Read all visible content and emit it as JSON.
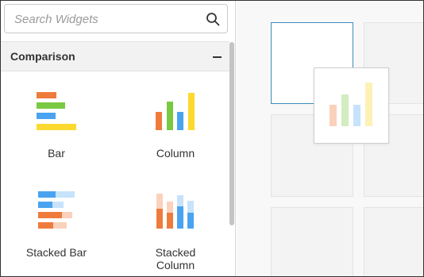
{
  "search": {
    "placeholder": "Search Widgets",
    "value": "",
    "icon": "search-icon"
  },
  "group": {
    "title": "Comparison",
    "collapse_icon": "minus-icon"
  },
  "widgets": [
    {
      "label": "Bar",
      "icon": "bar-chart-icon"
    },
    {
      "label": "Column",
      "icon": "column-chart-icon"
    },
    {
      "label": "Stacked Bar",
      "icon": "stacked-bar-chart-icon"
    },
    {
      "label": "Stacked Column",
      "icon": "stacked-column-chart-icon"
    }
  ],
  "drag_preview": {
    "icon": "column-chart-icon"
  },
  "colors": {
    "orange": "#ee7b3c",
    "green": "#7ac943",
    "blue": "#4aa3f0",
    "yellow": "#fcd92e",
    "canvas_active_border": "#3a8bbd"
  }
}
